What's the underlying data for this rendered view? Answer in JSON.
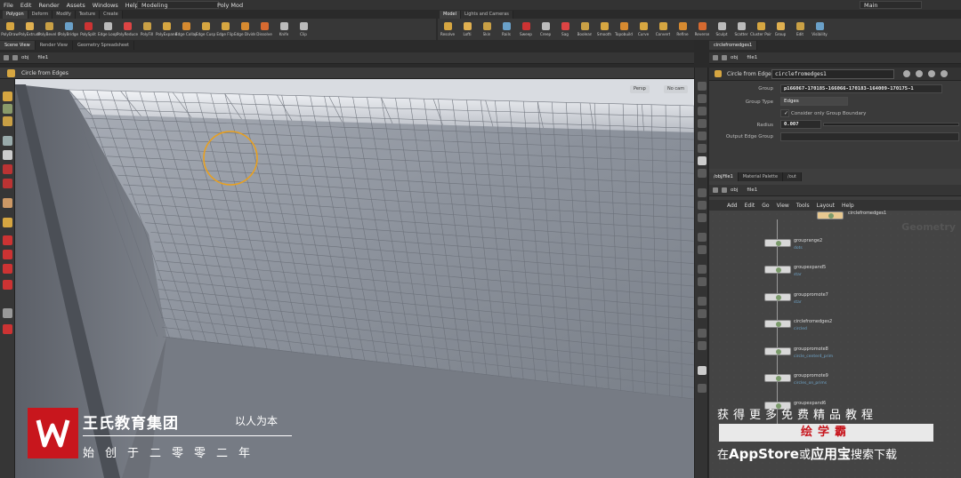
{
  "menu": [
    "File",
    "Edit",
    "Render",
    "Assets",
    "Windows",
    "Help"
  ],
  "desktop": "Modeling",
  "mode": "Poly Mod",
  "main_select": "Main",
  "shelf_tabs_left": [
    "Polygon",
    "Deform",
    "Modify",
    "Texture",
    "Create"
  ],
  "shelf_tabs_right": [
    "Model",
    "Lights and Cameras"
  ],
  "shelf_tools_left": [
    "PolyDraw",
    "PolyExtrude",
    "PolyBevel Old",
    "PolyBridge",
    "PolySplit",
    "Edge Loop",
    "PolyReduce",
    "PolyFill",
    "PolyExpand2D",
    "Edge Collapse",
    "Edge Cusp",
    "Edge Flip",
    "Edge Divide",
    "Dissolve",
    "Knife",
    "Clip"
  ],
  "shelf_tools_right": [
    "Resolve",
    "Lofti",
    "Skin",
    "Rails",
    "Sweep",
    "Creep",
    "Sag",
    "Boolean",
    "Smooth",
    "Topobuild",
    "Curve",
    "Convert",
    "Refine",
    "Reverse",
    "Sculpt",
    "Scatter",
    "Cluster Points",
    "Group",
    "Edit",
    "Visibility"
  ],
  "pane_tabs_left": [
    "Scene View",
    "Render View",
    "Geometry Spreadsheet"
  ],
  "pane_tabs_right": [
    "circlefromedges1"
  ],
  "path_left": [
    "obj",
    "file1"
  ],
  "path_right": [
    "obj",
    "file1"
  ],
  "viewport": {
    "title": "Circle from Edges",
    "persp": "Persp",
    "cam": "No cam"
  },
  "params": {
    "node_type": "Circle from Edges",
    "node_name": "circlefromedges1",
    "group_label": "Group",
    "group_value": "p166067-170185-166066-170183-164009-170175-1",
    "group_type_label": "Group Type",
    "group_type_value": "Edges",
    "consider_label": "Consider only Group Boundary",
    "radius_label": "Radius",
    "radius_value": "0.007",
    "output_label": "Output Edge Group"
  },
  "network": {
    "tabs": [
      "/obj/file1",
      "Material Palette",
      "/out"
    ],
    "path": [
      "obj",
      "file1"
    ],
    "menu": [
      "Add",
      "Edit",
      "Go",
      "View",
      "Tools",
      "Layout",
      "Help"
    ],
    "watermark": "Geometry",
    "nodes": [
      {
        "name": "circlefromedges1",
        "sub": ""
      },
      {
        "name": "grouprange2",
        "sub": "dots"
      },
      {
        "name": "groupexpand5",
        "sub": "star"
      },
      {
        "name": "grouppromote7",
        "sub": "star"
      },
      {
        "name": "circlefromedges2",
        "sub": "circled"
      },
      {
        "name": "grouppromote8",
        "sub": "circle_center4_prim"
      },
      {
        "name": "grouppromote9",
        "sub": "circles_on_prims"
      },
      {
        "name": "groupexpand6",
        "sub": ""
      },
      {
        "name": "polyextrude1",
        "sub": ""
      }
    ]
  },
  "brand": {
    "name": "王氏教育集团",
    "slogan": "以人为本",
    "since": "始创于二零零二年"
  },
  "promo": {
    "line1": "获得更多免费精品教程",
    "app_name": "绘学霸",
    "line3_pre": "在",
    "line3_store": "AppStore",
    "line3_mid": "或",
    "line3_app": "应用宝",
    "line3_post": "搜索下载"
  },
  "colors": {
    "brand_red": "#c8161d",
    "selection_orange": "#e8a020",
    "node_blue": "#6fa4c8"
  }
}
